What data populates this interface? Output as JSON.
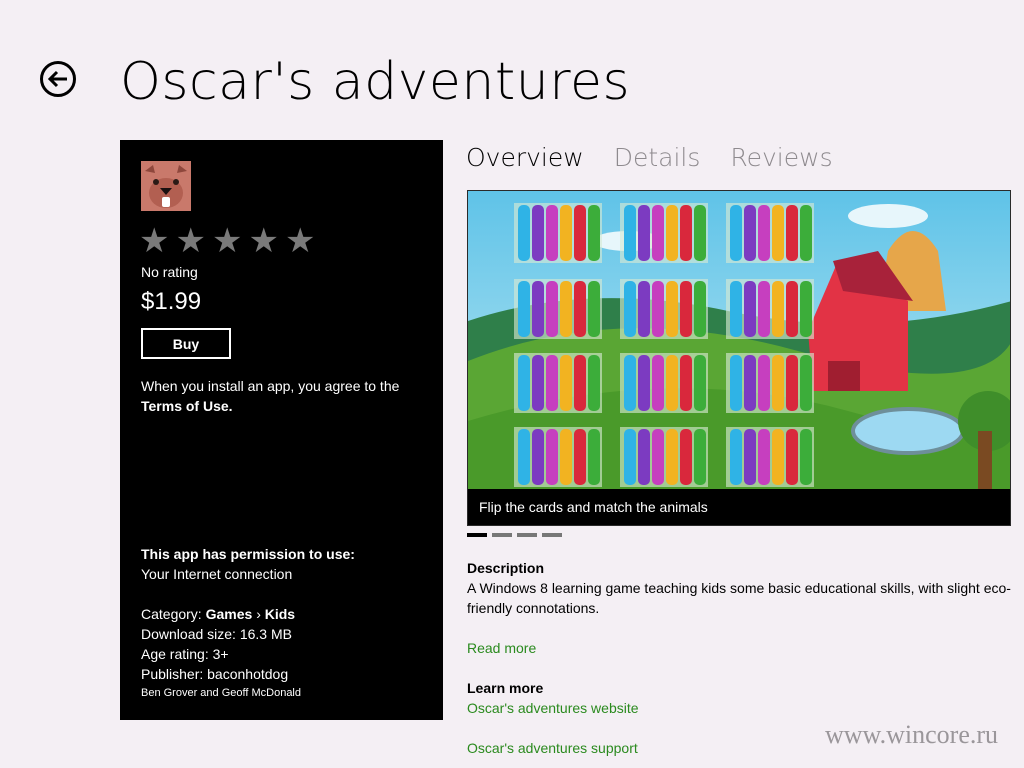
{
  "header": {
    "title": "Oscar's adventures"
  },
  "panel": {
    "rating_text": "No rating",
    "stars": [
      0,
      0,
      0,
      0,
      0
    ],
    "price": "$1.99",
    "buy_label": "Buy",
    "agree_text": "When you install an app, you agree to the ",
    "terms_link": "Terms of Use.",
    "permission_title": "This app has permission to use:",
    "permission_item": "Your Internet connection",
    "category_label": "Category: ",
    "category_value": "Games",
    "category_sep": "›",
    "category_sub": "Kids",
    "download_size": "Download size: 16.3 MB",
    "age_rating": "Age rating: 3+",
    "publisher": "Publisher: baconhotdog",
    "credits": "Ben Grover and Geoff McDonald"
  },
  "tabs": [
    {
      "label": "Overview",
      "active": true
    },
    {
      "label": "Details",
      "active": false
    },
    {
      "label": "Reviews",
      "active": false
    }
  ],
  "screenshot": {
    "caption": "Flip the cards and match the animals",
    "pages": 4,
    "active_page": 1
  },
  "description": {
    "heading": "Description",
    "text": "A Windows 8 learning game teaching kids some basic educational skills, with slight eco-friendly connotations.",
    "read_more": "Read more"
  },
  "learn_more": {
    "heading": "Learn more",
    "website": "Oscar's adventures website",
    "support": "Oscar's adventures support"
  },
  "watermark": "www.wincore.ru",
  "colors": {
    "accent_link": "#2a8a1e",
    "background": "#f4eff4",
    "panel": "#000000"
  }
}
